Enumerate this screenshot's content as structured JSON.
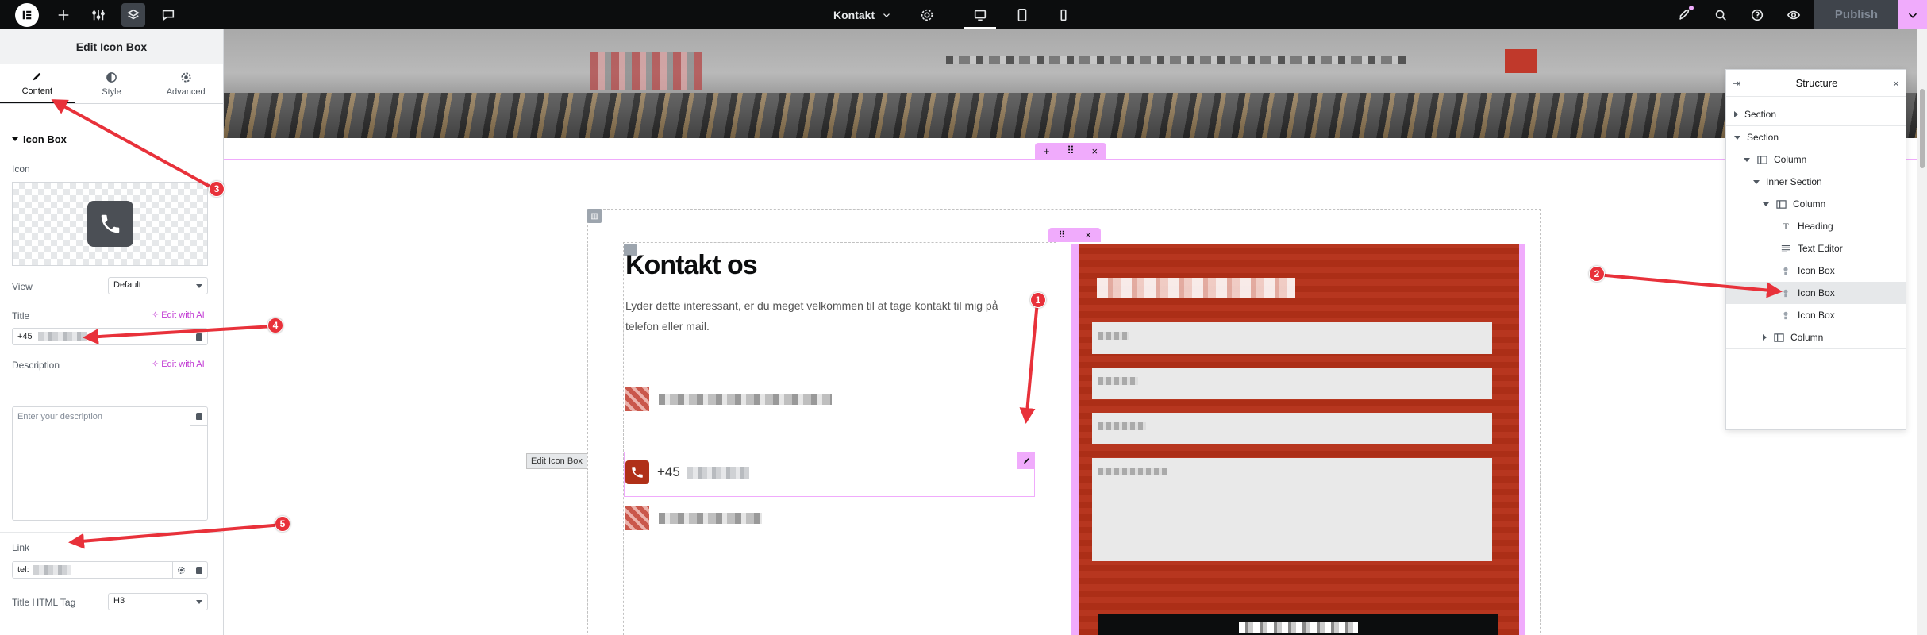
{
  "topbar": {
    "page_name": "Kontakt",
    "publish_label": "Publish",
    "icons": [
      "elementor-logo-icon",
      "plus-icon",
      "sliders-icon",
      "layers-icon",
      "chat-icon",
      "gear-icon",
      "desktop-icon",
      "tablet-icon",
      "mobile-icon",
      "rocket-icon",
      "search-icon",
      "help-icon",
      "eye-icon",
      "chevron-down-icon"
    ],
    "colors": {
      "background": "#0c0d0e",
      "accent": "#f0abfc"
    }
  },
  "panel": {
    "title": "Edit Icon Box",
    "tabs": [
      {
        "label": "Content",
        "icon": "pencil-icon",
        "active": true
      },
      {
        "label": "Style",
        "icon": "half-circle-icon",
        "active": false
      },
      {
        "label": "Advanced",
        "icon": "gear-icon",
        "active": false
      }
    ],
    "section_title": "Icon Box",
    "icon_label": "Icon",
    "view_label": "View",
    "view_value": "Default",
    "title_label": "Title",
    "edit_with_ai": "Edit with AI",
    "title_value": "+45",
    "description_label": "Description",
    "description_placeholder": "Enter your description",
    "link_label": "Link",
    "link_value": "tel:",
    "html_tag_label": "Title HTML Tag",
    "html_tag_value": "H3"
  },
  "canvas": {
    "heading": "Kontakt os",
    "intro": "Lyder dette interessant, er du meget velkommen til at tage kontakt til mig på telefon eller mail.",
    "selected_icon_box_title": "+45",
    "tooltip": "Edit Icon Box",
    "colors": {
      "brand_red": "#b53018",
      "selection": "#f0abfc"
    }
  },
  "structure": {
    "title": "Structure",
    "items": [
      {
        "label": "Section",
        "type": "section",
        "expanded": false
      },
      {
        "label": "Section",
        "type": "section",
        "expanded": true
      },
      {
        "label": "Column",
        "type": "column",
        "expanded": true
      },
      {
        "label": "Inner Section",
        "type": "section",
        "expanded": true
      },
      {
        "label": "Column",
        "type": "column",
        "expanded": true
      },
      {
        "label": "Heading",
        "type": "heading"
      },
      {
        "label": "Text Editor",
        "type": "text-editor"
      },
      {
        "label": "Icon Box",
        "type": "icon-box"
      },
      {
        "label": "Icon Box",
        "type": "icon-box",
        "selected": true
      },
      {
        "label": "Icon Box",
        "type": "icon-box"
      },
      {
        "label": "Column",
        "type": "column",
        "expanded": false
      }
    ]
  },
  "annotations": [
    "1",
    "2",
    "3",
    "4",
    "5"
  ]
}
